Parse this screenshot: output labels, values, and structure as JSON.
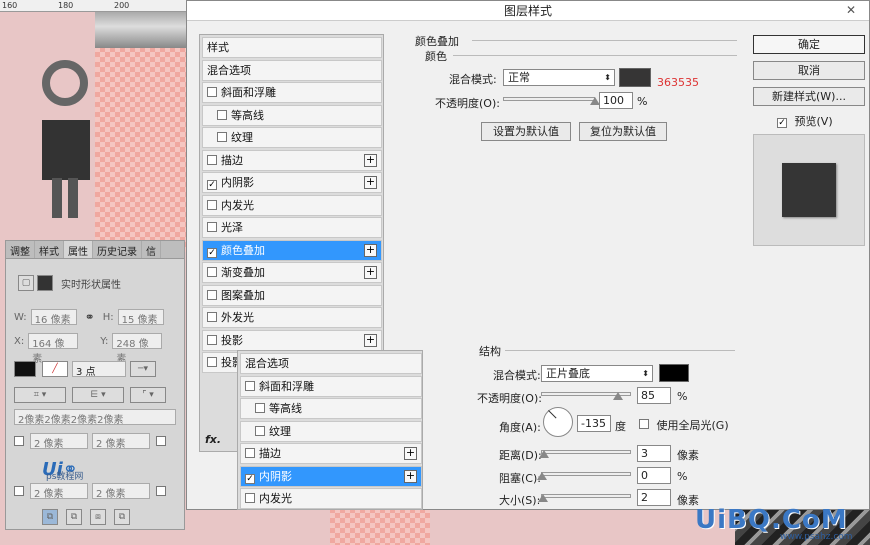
{
  "ruler": {
    "labels": [
      "160",
      "180",
      "200"
    ]
  },
  "properties_panel": {
    "tabs": [
      "调整",
      "样式",
      "属性",
      "历史记录",
      "信"
    ],
    "active_tab": "属性",
    "section_title": "实时形状属性",
    "w_label": "W:",
    "w_value": "16 像素",
    "h_label": "H:",
    "h_value": "15 像素",
    "x_label": "X:",
    "x_value": "164 像素",
    "y_label": "Y:",
    "y_value": "248 像素",
    "stroke_width": "3 点",
    "corner_values": "2像素2像素2像素2像素",
    "corner_tl": "2 像素",
    "corner_tr": "2 像素",
    "corner_bl": "2 像素",
    "corner_br": "2 像素",
    "logo_text": "ps教程网"
  },
  "dialog": {
    "title": "图层样式",
    "close": "✕",
    "styles": [
      {
        "label": "样式",
        "checkbox": false,
        "checked": false,
        "indent": 0,
        "plus": false,
        "selected": false
      },
      {
        "label": "混合选项",
        "checkbox": false,
        "checked": false,
        "indent": 0,
        "plus": false,
        "selected": false
      },
      {
        "label": "斜面和浮雕",
        "checkbox": true,
        "checked": false,
        "indent": 0,
        "plus": false,
        "selected": false
      },
      {
        "label": "等高线",
        "checkbox": true,
        "checked": false,
        "indent": 1,
        "plus": false,
        "selected": false
      },
      {
        "label": "纹理",
        "checkbox": true,
        "checked": false,
        "indent": 1,
        "plus": false,
        "selected": false
      },
      {
        "label": "描边",
        "checkbox": true,
        "checked": false,
        "indent": 0,
        "plus": true,
        "selected": false
      },
      {
        "label": "内阴影",
        "checkbox": true,
        "checked": true,
        "indent": 0,
        "plus": true,
        "selected": false
      },
      {
        "label": "内发光",
        "checkbox": true,
        "checked": false,
        "indent": 0,
        "plus": false,
        "selected": false
      },
      {
        "label": "光泽",
        "checkbox": true,
        "checked": false,
        "indent": 0,
        "plus": false,
        "selected": false
      },
      {
        "label": "颜色叠加",
        "checkbox": true,
        "checked": true,
        "indent": 0,
        "plus": true,
        "selected": true
      },
      {
        "label": "渐变叠加",
        "checkbox": true,
        "checked": false,
        "indent": 0,
        "plus": true,
        "selected": false
      },
      {
        "label": "图案叠加",
        "checkbox": true,
        "checked": false,
        "indent": 0,
        "plus": false,
        "selected": false
      },
      {
        "label": "外发光",
        "checkbox": true,
        "checked": false,
        "indent": 0,
        "plus": false,
        "selected": false
      },
      {
        "label": "投影",
        "checkbox": true,
        "checked": false,
        "indent": 0,
        "plus": true,
        "selected": false
      },
      {
        "label": "投影",
        "checkbox": true,
        "checked": false,
        "indent": 0,
        "plus": false,
        "selected": false
      }
    ],
    "fx_label": "fx.",
    "color_overlay": {
      "group_title": "颜色叠加",
      "sub_title": "颜色",
      "blend_label": "混合模式:",
      "blend_value": "正常",
      "color_hex_text": "363535",
      "swatch_color": "#363535",
      "opacity_label": "不透明度(O):",
      "opacity_value": "100",
      "opacity_unit": "%",
      "opacity_fraction": 1.0,
      "set_default": "设置为默认值",
      "reset_default": "复位为默认值"
    },
    "buttons": {
      "ok": "确定",
      "cancel": "取消",
      "new_style": "新建样式(W)...",
      "preview_label": "预览(V)",
      "preview_checked": true
    }
  },
  "overlay_list": {
    "items": [
      {
        "label": "混合选项",
        "checkbox": false,
        "checked": false,
        "indent": 0,
        "plus": false,
        "selected": false
      },
      {
        "label": "斜面和浮雕",
        "checkbox": true,
        "checked": false,
        "indent": 0,
        "plus": false,
        "selected": false
      },
      {
        "label": "等高线",
        "checkbox": true,
        "checked": false,
        "indent": 1,
        "plus": false,
        "selected": false
      },
      {
        "label": "纹理",
        "checkbox": true,
        "checked": false,
        "indent": 1,
        "plus": false,
        "selected": false
      },
      {
        "label": "描边",
        "checkbox": true,
        "checked": false,
        "indent": 0,
        "plus": true,
        "selected": false
      },
      {
        "label": "内阴影",
        "checkbox": true,
        "checked": true,
        "indent": 0,
        "plus": true,
        "selected": true
      },
      {
        "label": "内发光",
        "checkbox": true,
        "checked": false,
        "indent": 0,
        "plus": false,
        "selected": false
      }
    ]
  },
  "inner_shadow": {
    "group_title": "结构",
    "blend_label": "混合模式:",
    "blend_value": "正片叠底",
    "swatch_color": "#000000",
    "opacity_label": "不透明度(O):",
    "opacity_value": "85",
    "opacity_unit": "%",
    "opacity_fraction": 0.85,
    "angle_label": "角度(A):",
    "angle_value": "-135",
    "angle_unit": "度",
    "global_light_label": "使用全局光(G)",
    "global_light_checked": false,
    "distance_label": "距离(D):",
    "distance_value": "3",
    "distance_unit": "像素",
    "choke_label": "阻塞(C):",
    "choke_value": "0",
    "choke_unit": "%",
    "size_label": "大小(S):",
    "size_value": "2",
    "size_unit": "像素"
  },
  "watermark": {
    "main": "UiBQ.CoM",
    "sub": "www.psahz.com"
  }
}
